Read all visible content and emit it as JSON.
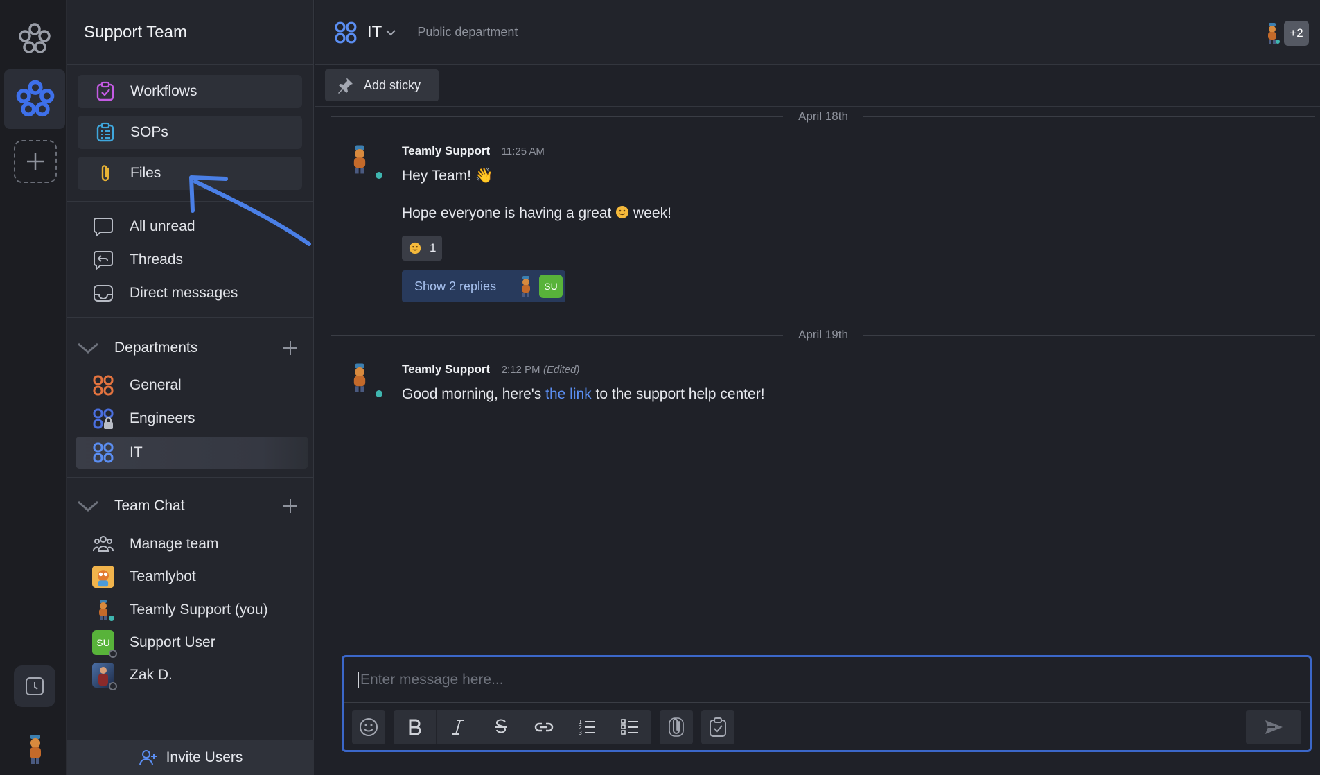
{
  "workspace": {
    "name": "Support Team"
  },
  "tools": [
    {
      "label": "Workflows",
      "icon": "workflow-icon"
    },
    {
      "label": "SOPs",
      "icon": "sop-icon"
    },
    {
      "label": "Files",
      "icon": "paperclip-icon"
    }
  ],
  "nav": [
    {
      "label": "All unread",
      "icon": "chat-bubble-icon"
    },
    {
      "label": "Threads",
      "icon": "threads-icon"
    },
    {
      "label": "Direct messages",
      "icon": "inbox-icon"
    }
  ],
  "departments": {
    "title": "Departments",
    "items": [
      {
        "label": "General"
      },
      {
        "label": "Engineers"
      },
      {
        "label": "IT"
      }
    ]
  },
  "team_chat": {
    "title": "Team Chat",
    "items": [
      {
        "label": "Manage team"
      },
      {
        "label": "Teamlybot"
      },
      {
        "label": "Teamly Support (you)"
      },
      {
        "label": "Support User",
        "initials": "SU"
      },
      {
        "label": "Zak D."
      }
    ]
  },
  "invite_label": "Invite Users",
  "channel": {
    "name": "IT",
    "description": "Public department",
    "extra_members": "+2"
  },
  "add_sticky_label": "Add sticky",
  "messages": [
    {
      "date": "April 18th",
      "author": "Teamly Support",
      "time": "11:25 AM",
      "line1": "Hey Team! 👋",
      "line2a": "Hope everyone is having a great",
      "line2b": "week!",
      "reaction_count": "1",
      "replies_label": "Show 2 replies",
      "reply_initials": "SU"
    },
    {
      "date": "April 19th",
      "author": "Teamly Support",
      "time": "2:12 PM",
      "edited": "(Edited)",
      "text_a": "Good morning, here's",
      "link": "the link",
      "text_b": "to the support help center!"
    }
  ],
  "composer": {
    "placeholder": "Enter message here..."
  },
  "colors": {
    "accent": "#3b67c9",
    "link": "#5b8ef2",
    "status_online": "#3fb6b0",
    "su_green": "#58b33a"
  }
}
